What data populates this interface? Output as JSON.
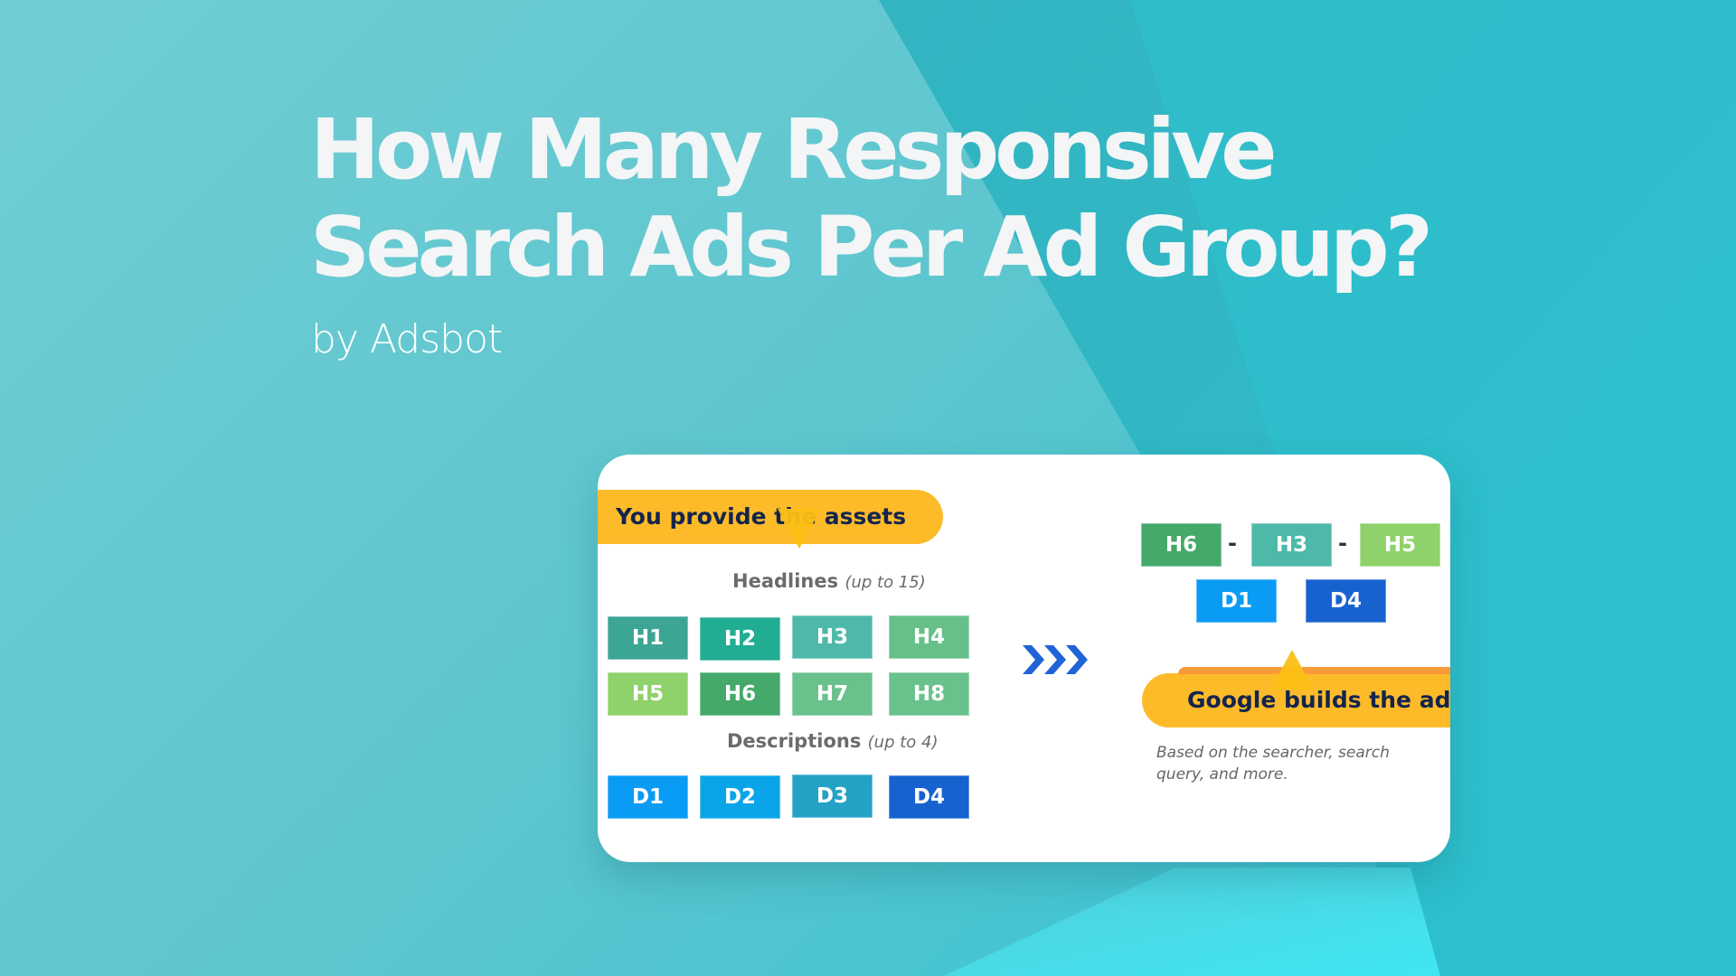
{
  "header": {
    "title_line1": "How Many Responsive",
    "title_line2": "Search Ads Per Ad Group?",
    "byline": "by Adsbot"
  },
  "colors": {
    "background_light": "#6dcbd2",
    "background_teal": "#2ac4d2",
    "band_dark": "#33b3c0",
    "banner_yellow": "#fdbb2a",
    "banner_orange": "#f8993a",
    "banner_text": "#14254d",
    "arrow_blue": "#1f63d6"
  },
  "diagram": {
    "assets_banner": "You provide the assets",
    "headlines_label": "Headlines",
    "headlines_limit": "(up to 15)",
    "headlines": [
      {
        "label": "H1",
        "color": "#3da594"
      },
      {
        "label": "H2",
        "color": "#21ad92"
      },
      {
        "label": "H3",
        "color": "#4eb9a8"
      },
      {
        "label": "H4",
        "color": "#67c08a"
      },
      {
        "label": "H5",
        "color": "#8fd16b"
      },
      {
        "label": "H6",
        "color": "#44a96a"
      },
      {
        "label": "H7",
        "color": "#69c18b"
      },
      {
        "label": "H8",
        "color": "#69c18b"
      }
    ],
    "descriptions_label": "Descriptions",
    "descriptions_limit": "(up to 4)",
    "descriptions": [
      {
        "label": "D1",
        "color": "#0a9bf5"
      },
      {
        "label": "D2",
        "color": "#0aa5e8"
      },
      {
        "label": "D3",
        "color": "#24a2c6"
      },
      {
        "label": "D4",
        "color": "#1862d0"
      }
    ],
    "arrow_icon": "triple-chevron-right",
    "result_headlines": [
      {
        "label": "H6",
        "color": "#44a96a"
      },
      {
        "label": "H3",
        "color": "#4eb9a8"
      },
      {
        "label": "H5",
        "color": "#8fd16b"
      }
    ],
    "separator": "-",
    "result_descriptions": [
      {
        "label": "D1",
        "color": "#0a9bf5"
      },
      {
        "label": "D4",
        "color": "#1862d0"
      }
    ],
    "google_banner": "Google builds the ad",
    "note": "Based on the searcher, search query, and more."
  }
}
